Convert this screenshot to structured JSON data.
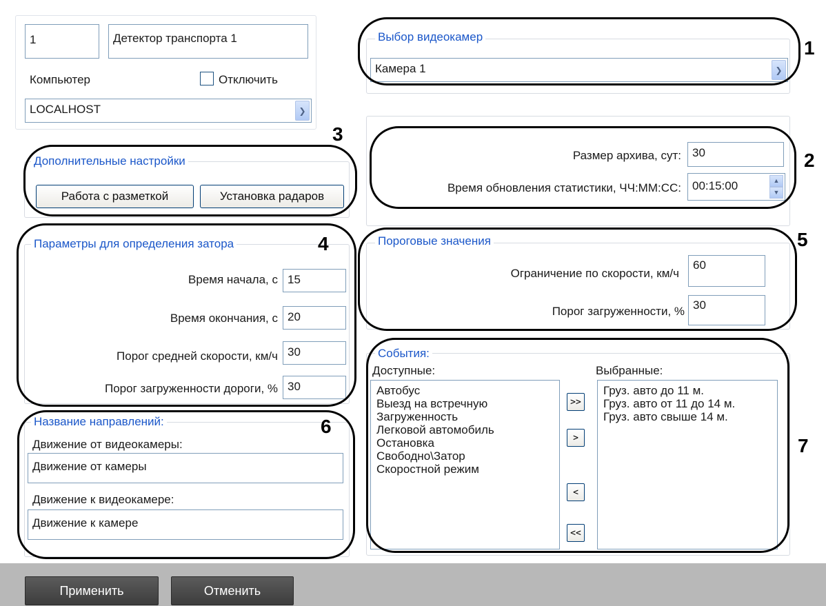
{
  "module": {
    "id": "1",
    "name": "Детектор транспорта 1",
    "computer_label": "Компьютер",
    "disable_label": "Отключить",
    "computer_value": "LOCALHOST"
  },
  "camera": {
    "legend": "Выбор видеокамер",
    "value": "Камера 1"
  },
  "archive": {
    "size_label": "Размер архива, сут:",
    "size_value": "30",
    "stats_label": "Время обновления статистики, ЧЧ:ММ:СС:",
    "stats_value": "00:15:00"
  },
  "extra": {
    "legend": "Дополнительные настройки",
    "markup_button": "Работа с разметкой",
    "radar_button": "Установка радаров"
  },
  "jam": {
    "legend": "Параметры для определения затора",
    "start_label": "Время начала, с",
    "start_value": "15",
    "end_label": "Время окончания, с",
    "end_value": "20",
    "speed_label": "Порог средней скорости, км/ч",
    "speed_value": "30",
    "load_label": "Порог загруженности дороги,  %",
    "load_value": "30"
  },
  "thresholds": {
    "legend": "Пороговые значения",
    "speed_limit_label": "Ограничение по скорости, км/ч",
    "speed_limit_value": "60",
    "load_label": "Порог загруженности, %",
    "load_value": "30"
  },
  "directions": {
    "legend": "Название направлений:",
    "from_label": "Движение от видеокамеры:",
    "from_value": "Движение от камеры",
    "to_label": "Движение к видеокамере:",
    "to_value": "Движение к камере"
  },
  "events": {
    "legend": "События:",
    "available_label": "Доступные:",
    "selected_label": "Выбранные:",
    "available": [
      "Автобус",
      "Выезд на встречную",
      "Загруженность",
      "Легковой автомобиль",
      "Остановка",
      "Свободно\\Затор",
      "Скоростной режим"
    ],
    "selected": [
      "Груз. авто до 11 м.",
      "Груз. авто от 11 до 14 м.",
      "Груз. авто свыше 14 м."
    ],
    "add_all": ">>",
    "add_one": ">",
    "remove_one": "<",
    "remove_all": "<<"
  },
  "callouts": [
    "1",
    "2",
    "3",
    "4",
    "5",
    "6",
    "7"
  ],
  "footer": {
    "apply": "Применить",
    "cancel": "Отменить"
  },
  "colors": {
    "legend_text": "#1b57c9",
    "footer_bar": "#b8b8b8",
    "dark_button": "#4a4a4a"
  },
  "icons": [
    "chevron-down-icon",
    "spin-up-icon",
    "spin-down-icon",
    "checkbox-icon"
  ]
}
